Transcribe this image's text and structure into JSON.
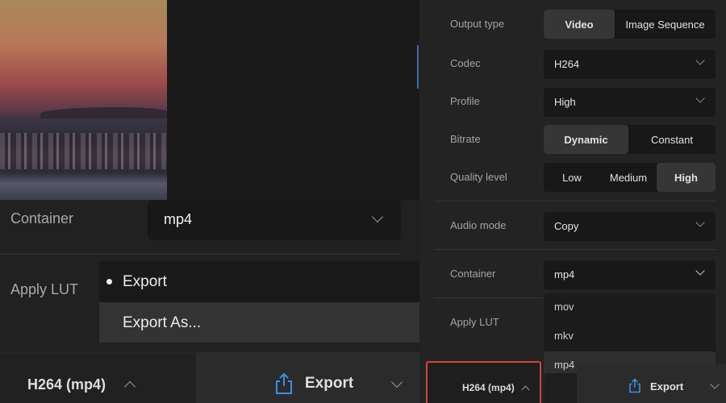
{
  "zoomed_view": {
    "container_label": "Container",
    "container_value": "mp4",
    "apply_lut_label": "Apply LUT",
    "export_menu": [
      {
        "label": "Export",
        "selected": true
      },
      {
        "label": "Export As...",
        "hovered": true
      }
    ],
    "format_button": "H264 (mp4)",
    "export_button": "Export"
  },
  "panel": {
    "output_type": {
      "label": "Output type",
      "options": [
        "Video",
        "Image Sequence"
      ],
      "selected": "Video"
    },
    "codec": {
      "label": "Codec",
      "value": "H264"
    },
    "profile": {
      "label": "Profile",
      "value": "High"
    },
    "bitrate": {
      "label": "Bitrate",
      "options": [
        "Dynamic",
        "Constant"
      ],
      "selected": "Dynamic"
    },
    "quality_level": {
      "label": "Quality level",
      "options": [
        "Low",
        "Medium",
        "High"
      ],
      "selected": "High"
    },
    "audio_mode": {
      "label": "Audio mode",
      "value": "Copy"
    },
    "container": {
      "label": "Container",
      "value": "mp4",
      "options": [
        "mov",
        "mkv",
        "mp4"
      ],
      "selected": "mp4"
    },
    "apply_lut": {
      "label": "Apply LUT"
    },
    "format_button": "H264 (mp4)",
    "export_button": "Export"
  },
  "colors": {
    "accent_blue": "#3a8ee6",
    "highlight_red": "#d84040"
  }
}
